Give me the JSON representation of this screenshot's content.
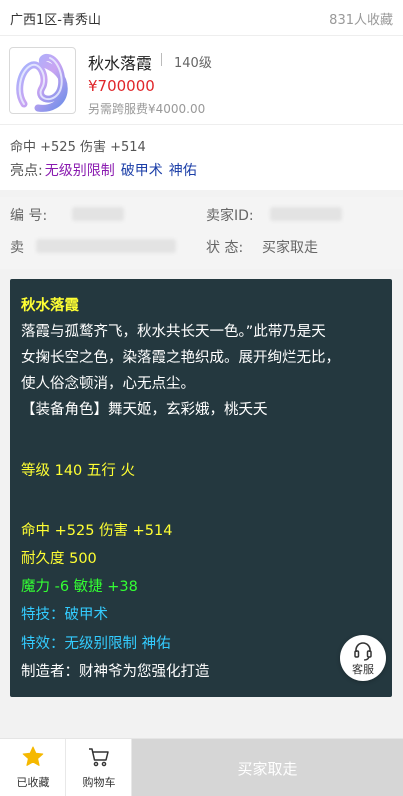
{
  "header": {
    "server": "广西1区-青秀山",
    "favorites": "831人收藏"
  },
  "item": {
    "name": "秋水落霞",
    "level": "140级",
    "price": "¥700000",
    "fee": "另需跨服费¥4000.00",
    "image_icon": "ribbon-icon"
  },
  "attributes": "命中 +525 伤害 +514",
  "highlights": {
    "label": "亮点:",
    "items": [
      "无级别限制",
      "破甲术",
      "神佑"
    ],
    "colors": [
      "#8a1bb0",
      "#1c3fa8",
      "#1c3fa8"
    ]
  },
  "info": {
    "number_label": "编  号:",
    "seller_id_label": "卖家ID:",
    "seller_label": "卖",
    "status_label": "状  态:",
    "status_value": "买家取走"
  },
  "description": {
    "title": "秋水落霞",
    "lines": [
      "落霞与孤鹜齐飞，秋水共长天一色。”此带乃是天",
      "女掬长空之色，染落霞之艳织成。展开绚烂无比，",
      "使人俗念顿消，心无点尘。",
      "【装备角色】舞天姬，玄彩娥，桃夭夭"
    ],
    "level_line": "等级 140  五行 火",
    "attr_line": "命中 +525 伤害 +514",
    "durability": "耐久度 500",
    "magic_line": "魔力 -6 敏捷 +38",
    "skill": "特技：破甲术",
    "effect": "特效：无级别限制 神佑",
    "maker": "制造者：财神爷为您强化打造"
  },
  "customer_service": {
    "label": "客服",
    "icon": "headset-icon"
  },
  "bottom_bar": {
    "favorite_label": "已收藏",
    "favorite_icon": "star-icon",
    "cart_label": "购物车",
    "cart_icon": "cart-icon",
    "main_button": "买家取走"
  },
  "colors": {
    "price": "#e0262a",
    "desc_bg": "#24383f",
    "star": "#f5b800"
  }
}
